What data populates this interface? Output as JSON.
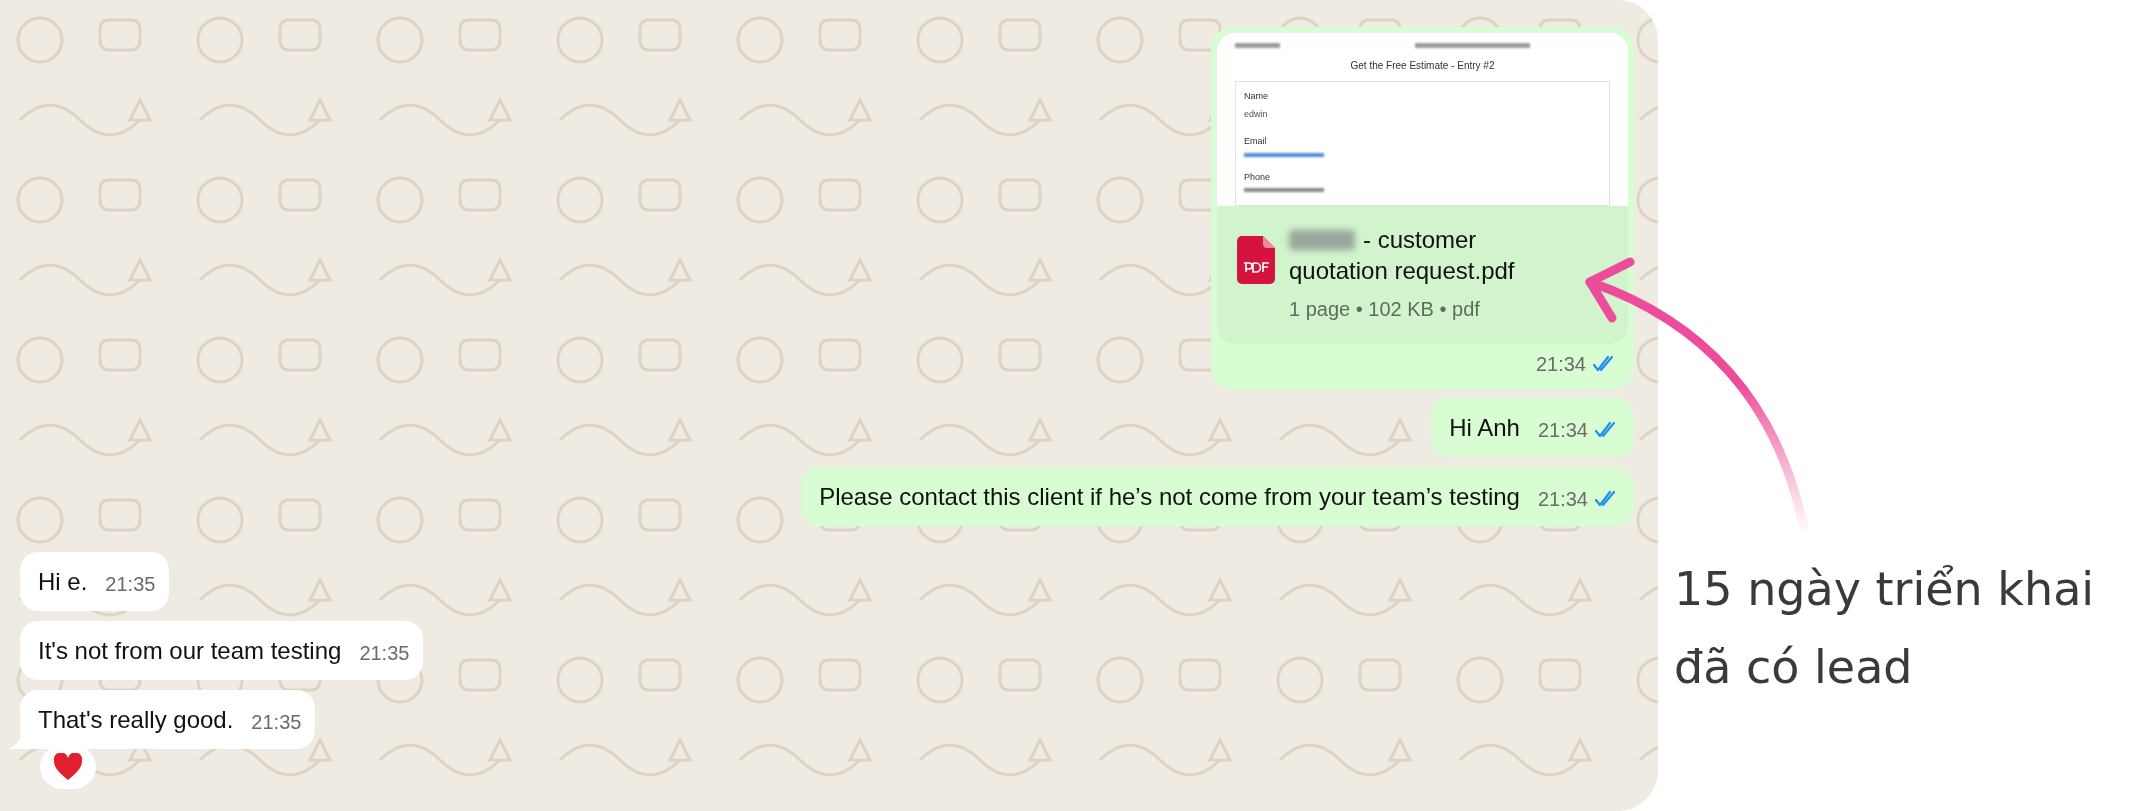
{
  "chat": {
    "messages": [
      {
        "kind": "document",
        "outgoing": true,
        "preview": {
          "title": "Get the Free Estimate - Entry #2",
          "fields": [
            {
              "label": "Name",
              "value": "edwin"
            },
            {
              "label": "Email"
            },
            {
              "label": "Phone"
            }
          ]
        },
        "file_name_lines": [
          "- customer",
          "quotation request.pdf"
        ],
        "file_meta": "1 page • 102 KB • pdf",
        "time": "21:34",
        "read": true
      },
      {
        "kind": "text",
        "outgoing": true,
        "text": "Hi Anh",
        "time": "21:34",
        "read": true
      },
      {
        "kind": "text",
        "outgoing": true,
        "text": "Please contact this client if he’s not come from your team’s testing",
        "time": "21:34",
        "read": true
      },
      {
        "kind": "text",
        "outgoing": false,
        "text": "Hi e.",
        "time": "21:35"
      },
      {
        "kind": "text",
        "outgoing": false,
        "text": "It's not from our team testing",
        "time": "21:35"
      },
      {
        "kind": "text",
        "outgoing": false,
        "text": "That's really good.",
        "time": "21:35",
        "tail": true,
        "reaction": true
      }
    ]
  },
  "annotation": {
    "lines": [
      "15 ngày triển khai",
      "đã có lead"
    ]
  }
}
